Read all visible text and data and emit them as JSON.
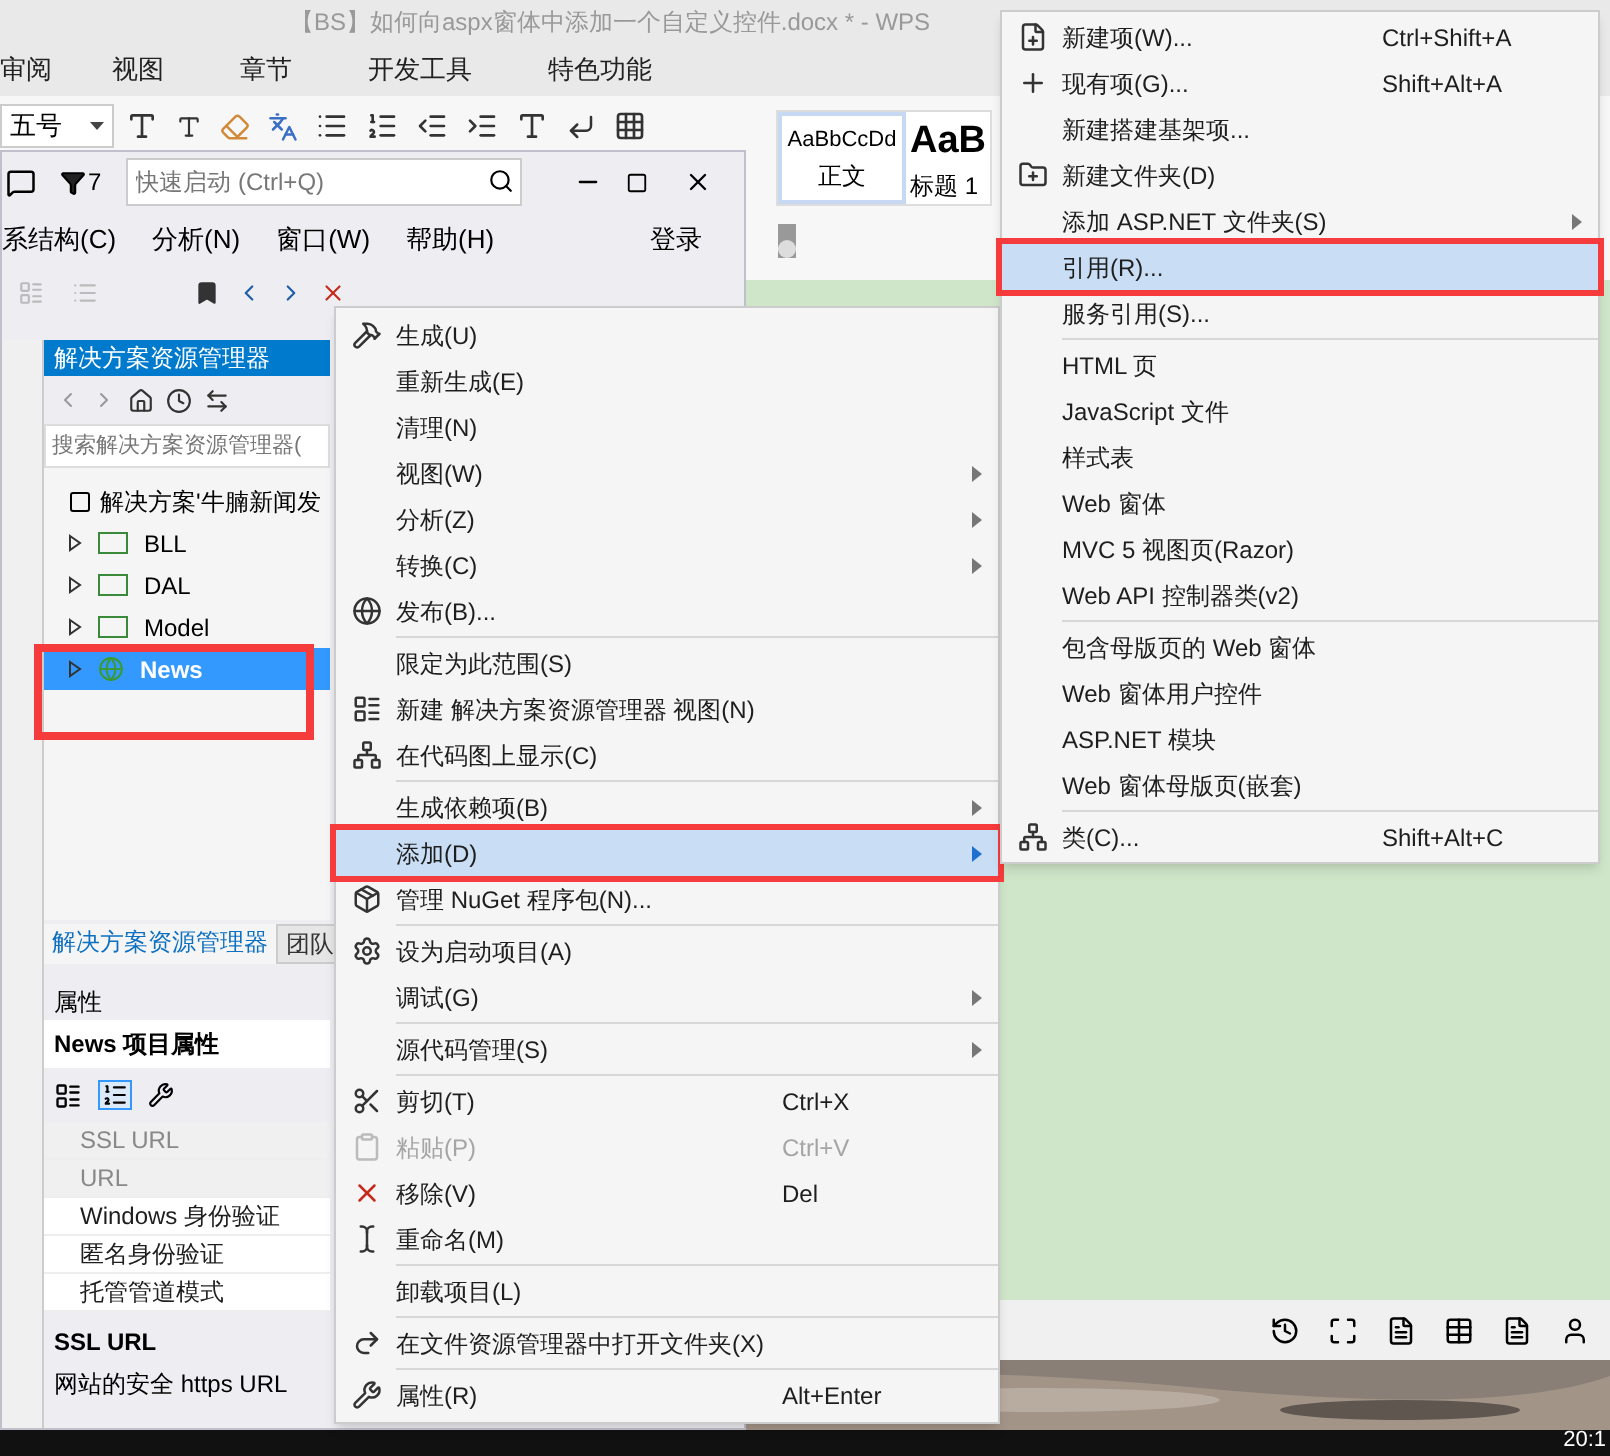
{
  "wps": {
    "title": "【BS】如何向aspx窗体中添加一个自定义控件.docx * - WPS",
    "ribbon_tabs": [
      "审阅",
      "视图",
      "章节",
      "开发工具",
      "特色功能"
    ],
    "font_size": "五号",
    "styles": [
      {
        "preview": "AaBbCcDd",
        "label": "正文",
        "selected": true
      },
      {
        "preview": "AaB",
        "label": "标题 1",
        "selected": false
      }
    ],
    "clock": "20:1"
  },
  "vs": {
    "filter_count": "7",
    "quick_launch": {
      "placeholder": "快速启动 (Ctrl+Q)"
    },
    "menu": [
      "系结构(C)",
      "分析(N)",
      "窗口(W)",
      "帮助(H)"
    ],
    "sign_in": "登录"
  },
  "solution_explorer": {
    "title": "解决方案资源管理器",
    "search": {
      "placeholder": "搜索解决方案资源管理器("
    },
    "root": "解决方案'牛腩新闻发",
    "projects": [
      {
        "name": "BLL",
        "expanded": false,
        "selected": false,
        "kind": "csharp"
      },
      {
        "name": "DAL",
        "expanded": false,
        "selected": false,
        "kind": "csharp"
      },
      {
        "name": "Model",
        "expanded": false,
        "selected": false,
        "kind": "csharp"
      },
      {
        "name": "News",
        "expanded": false,
        "selected": true,
        "kind": "web"
      }
    ],
    "tabs": [
      {
        "label": "解决方案资源管理器",
        "selected": true
      },
      {
        "label": "团队",
        "selected": false
      }
    ]
  },
  "properties": {
    "title": "属性",
    "subject": "News 项目属性",
    "rows": [
      {
        "name": "SSL URL",
        "disabled": true
      },
      {
        "name": "URL",
        "disabled": true
      },
      {
        "name": "Windows 身份验证",
        "disabled": false
      },
      {
        "name": "匿名身份验证",
        "disabled": false
      },
      {
        "name": "托管管道模式",
        "disabled": false
      }
    ],
    "description_title": "SSL URL",
    "description": "网站的安全 https URL"
  },
  "context_menu": [
    {
      "kind": "item",
      "label": "生成(U)",
      "submenu": false,
      "disabled": false,
      "selected": false
    },
    {
      "kind": "item",
      "label": "重新生成(E)",
      "submenu": false,
      "disabled": false,
      "selected": false
    },
    {
      "kind": "item",
      "label": "清理(N)",
      "submenu": false,
      "disabled": false,
      "selected": false
    },
    {
      "kind": "item",
      "label": "视图(W)",
      "submenu": true,
      "disabled": false,
      "selected": false
    },
    {
      "kind": "item",
      "label": "分析(Z)",
      "submenu": true,
      "disabled": false,
      "selected": false
    },
    {
      "kind": "item",
      "label": "转换(C)",
      "submenu": true,
      "disabled": false,
      "selected": false
    },
    {
      "kind": "item",
      "label": "发布(B)...",
      "submenu": false,
      "disabled": false,
      "selected": false
    },
    {
      "kind": "separator"
    },
    {
      "kind": "item",
      "label": "限定为此范围(S)",
      "submenu": false,
      "disabled": false,
      "selected": false
    },
    {
      "kind": "item",
      "label": "新建 解决方案资源管理器 视图(N)",
      "submenu": false,
      "disabled": false,
      "selected": false
    },
    {
      "kind": "item",
      "label": "在代码图上显示(C)",
      "submenu": false,
      "disabled": false,
      "selected": false
    },
    {
      "kind": "separator"
    },
    {
      "kind": "item",
      "label": "生成依赖项(B)",
      "submenu": true,
      "disabled": false,
      "selected": false
    },
    {
      "kind": "item",
      "label": "添加(D)",
      "submenu": true,
      "disabled": false,
      "selected": true
    },
    {
      "kind": "item",
      "label": "管理 NuGet 程序包(N)...",
      "submenu": false,
      "disabled": false,
      "selected": false
    },
    {
      "kind": "separator"
    },
    {
      "kind": "item",
      "label": "设为启动项目(A)",
      "submenu": false,
      "disabled": false,
      "selected": false
    },
    {
      "kind": "item",
      "label": "调试(G)",
      "submenu": true,
      "disabled": false,
      "selected": false
    },
    {
      "kind": "separator"
    },
    {
      "kind": "item",
      "label": "源代码管理(S)",
      "submenu": true,
      "disabled": false,
      "selected": false
    },
    {
      "kind": "separator"
    },
    {
      "kind": "item",
      "label": "剪切(T)",
      "shortcut": "Ctrl+X",
      "submenu": false,
      "disabled": false,
      "selected": false
    },
    {
      "kind": "item",
      "label": "粘贴(P)",
      "shortcut": "Ctrl+V",
      "submenu": false,
      "disabled": true,
      "selected": false
    },
    {
      "kind": "item",
      "label": "移除(V)",
      "shortcut": "Del",
      "submenu": false,
      "disabled": false,
      "selected": false
    },
    {
      "kind": "item",
      "label": "重命名(M)",
      "submenu": false,
      "disabled": false,
      "selected": false
    },
    {
      "kind": "separator"
    },
    {
      "kind": "item",
      "label": "卸载项目(L)",
      "submenu": false,
      "disabled": false,
      "selected": false
    },
    {
      "kind": "separator"
    },
    {
      "kind": "item",
      "label": "在文件资源管理器中打开文件夹(X)",
      "submenu": false,
      "disabled": false,
      "selected": false
    },
    {
      "kind": "separator"
    },
    {
      "kind": "item",
      "label": "属性(R)",
      "shortcut": "Alt+Enter",
      "submenu": false,
      "disabled": false,
      "selected": false
    }
  ],
  "add_submenu": [
    {
      "kind": "item",
      "label": "新建项(W)...",
      "shortcut": "Ctrl+Shift+A",
      "submenu": false,
      "selected": false
    },
    {
      "kind": "item",
      "label": "现有项(G)...",
      "shortcut": "Shift+Alt+A",
      "submenu": false,
      "selected": false
    },
    {
      "kind": "item",
      "label": "新建搭建基架项...",
      "submenu": false,
      "selected": false
    },
    {
      "kind": "item",
      "label": "新建文件夹(D)",
      "submenu": false,
      "selected": false
    },
    {
      "kind": "item",
      "label": "添加 ASP.NET 文件夹(S)",
      "submenu": true,
      "selected": false
    },
    {
      "kind": "item",
      "label": "引用(R)...",
      "submenu": false,
      "selected": true
    },
    {
      "kind": "item",
      "label": "服务引用(S)...",
      "submenu": false,
      "selected": false
    },
    {
      "kind": "separator"
    },
    {
      "kind": "item",
      "label": "HTML 页",
      "submenu": false,
      "selected": false
    },
    {
      "kind": "item",
      "label": "JavaScript 文件",
      "submenu": false,
      "selected": false
    },
    {
      "kind": "item",
      "label": "样式表",
      "submenu": false,
      "selected": false
    },
    {
      "kind": "item",
      "label": "Web 窗体",
      "submenu": false,
      "selected": false
    },
    {
      "kind": "item",
      "label": "MVC 5 视图页(Razor)",
      "submenu": false,
      "selected": false
    },
    {
      "kind": "item",
      "label": "Web API 控制器类(v2)",
      "submenu": false,
      "selected": false
    },
    {
      "kind": "separator"
    },
    {
      "kind": "item",
      "label": "包含母版页的 Web 窗体",
      "submenu": false,
      "selected": false
    },
    {
      "kind": "item",
      "label": "Web 窗体用户控件",
      "submenu": false,
      "selected": false
    },
    {
      "kind": "item",
      "label": "ASP.NET 模块",
      "submenu": false,
      "selected": false
    },
    {
      "kind": "item",
      "label": "Web 窗体母版页(嵌套)",
      "submenu": false,
      "selected": false
    },
    {
      "kind": "separator"
    },
    {
      "kind": "item",
      "label": "类(C)...",
      "shortcut": "Shift+Alt+C",
      "submenu": false,
      "selected": false
    }
  ]
}
